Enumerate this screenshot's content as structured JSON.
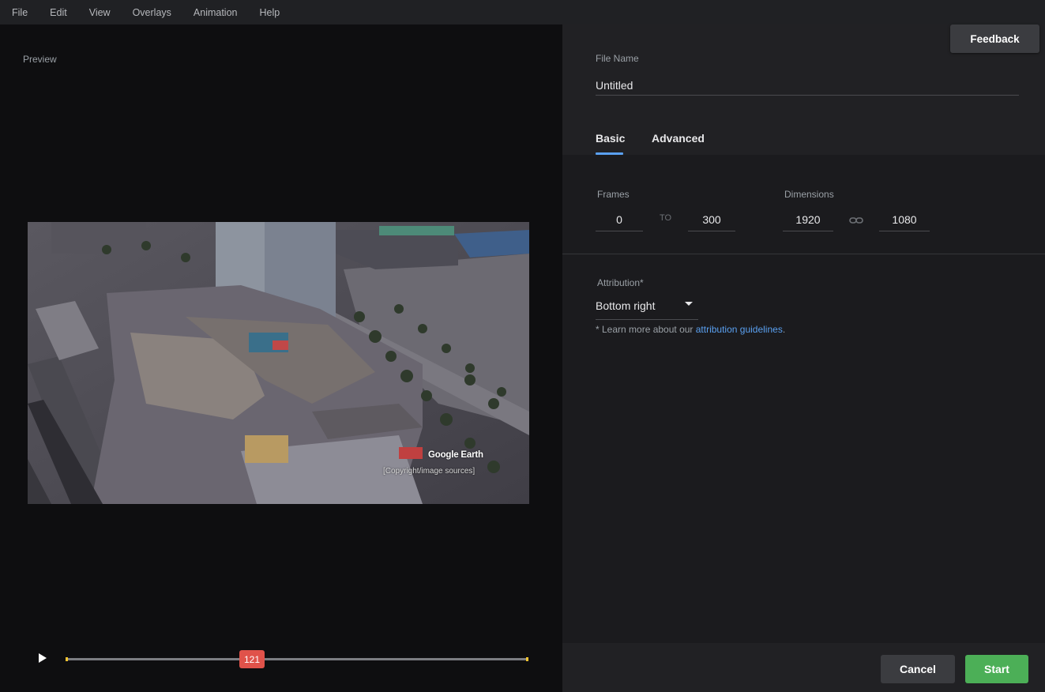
{
  "menu": [
    "File",
    "Edit",
    "View",
    "Overlays",
    "Animation",
    "Help"
  ],
  "preview": {
    "label": "Preview",
    "map_logo": "Google Earth",
    "map_copyright": "[Copyright/image sources]",
    "current_frame": "121",
    "play_icon": "play-icon"
  },
  "panel": {
    "feedback_label": "Feedback",
    "file_name_label": "File Name",
    "file_name_value": "Untitled",
    "tabs": [
      "Basic",
      "Advanced"
    ],
    "active_tab": "Basic",
    "frames_label": "Frames",
    "frame_start": "0",
    "frame_to": "TO",
    "frame_end": "300",
    "dimensions_label": "Dimensions",
    "width": "1920",
    "height": "1080",
    "link_icon": "link-icon",
    "attribution_label": "Attribution*",
    "attribution_value": "Bottom right",
    "attribution_note_prefix": "* Learn more about our ",
    "attribution_link": "attribution guidelines",
    "attribution_note_suffix": ".",
    "cancel_label": "Cancel",
    "start_label": "Start"
  },
  "colors": {
    "accent": "#5aa0f0",
    "start": "#4caf57",
    "frame_badge": "#e0524a"
  }
}
